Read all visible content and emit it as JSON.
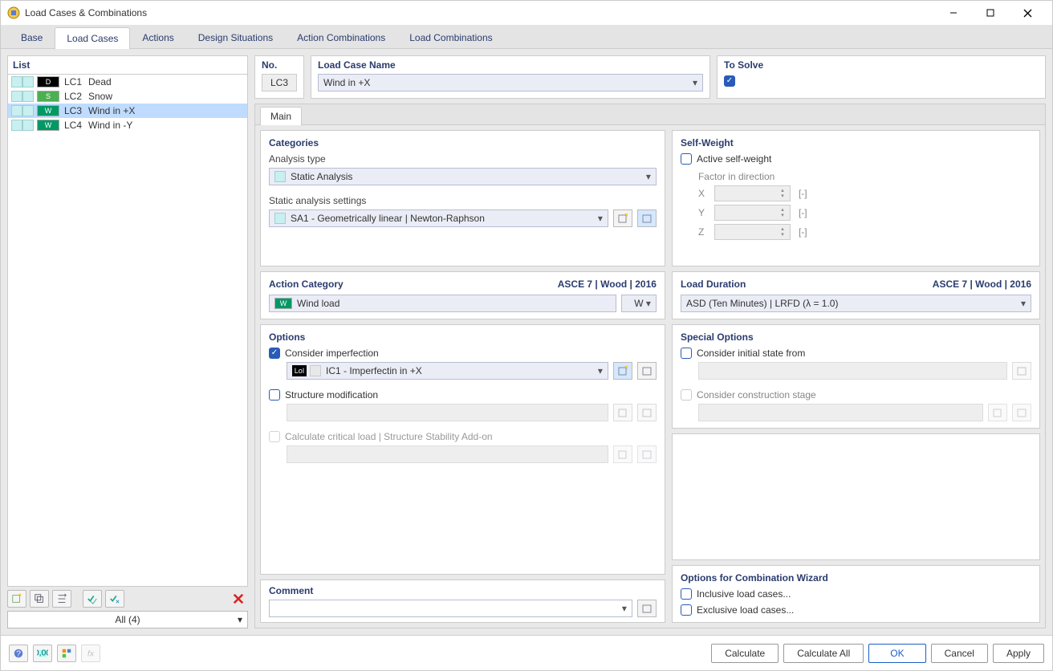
{
  "window": {
    "title": "Load Cases & Combinations"
  },
  "tabs": {
    "items": [
      "Base",
      "Load Cases",
      "Actions",
      "Design Situations",
      "Action Combinations",
      "Load Combinations"
    ],
    "active": 1
  },
  "list": {
    "header": "List",
    "rows": [
      {
        "badge": "D",
        "badge_cls": "black",
        "lc": "LC1",
        "name": "Dead"
      },
      {
        "badge": "S",
        "badge_cls": "green",
        "lc": "LC2",
        "name": "Snow"
      },
      {
        "badge": "W",
        "badge_cls": "darkgreen",
        "lc": "LC3",
        "name": "Wind in +X"
      },
      {
        "badge": "W",
        "badge_cls": "darkgreen",
        "lc": "LC4",
        "name": "Wind in -Y"
      }
    ],
    "selected": 2,
    "filter": "All (4)"
  },
  "header_form": {
    "no_label": "No.",
    "no_value": "LC3",
    "name_label": "Load Case Name",
    "name_value": "Wind in +X",
    "tosolve_label": "To Solve"
  },
  "inner_tabs": {
    "items": [
      "Main"
    ]
  },
  "categories": {
    "title": "Categories",
    "analysis_type_label": "Analysis type",
    "analysis_type_value": "Static Analysis",
    "static_settings_label": "Static analysis settings",
    "static_settings_value": "SA1 - Geometrically linear | Newton-Raphson"
  },
  "self_weight": {
    "title": "Self-Weight",
    "active_label": "Active self-weight",
    "factor_label": "Factor in direction",
    "axes": [
      "X",
      "Y",
      "Z"
    ],
    "bracket": "[-]"
  },
  "action_category": {
    "title": "Action Category",
    "sub": "ASCE 7 | Wood | 2016",
    "value": "Wind load",
    "short": "W"
  },
  "load_duration": {
    "title": "Load Duration",
    "sub": "ASCE 7 | Wood | 2016",
    "value": "ASD (Ten Minutes) | LRFD (λ = 1.0)"
  },
  "options": {
    "title": "Options",
    "consider_imperfection": "Consider imperfection",
    "imperfection_badge": "LoI",
    "imperfection_value": "IC1 - Imperfectin in +X",
    "structure_mod": "Structure modification",
    "calc_critical": "Calculate critical load | Structure Stability Add-on"
  },
  "special_options": {
    "title": "Special Options",
    "initial_state": "Consider initial state from",
    "construction_stage": "Consider construction stage"
  },
  "combination_wizard": {
    "title": "Options for Combination Wizard",
    "inclusive": "Inclusive load cases...",
    "exclusive": "Exclusive load cases..."
  },
  "comment": {
    "title": "Comment"
  },
  "footer": {
    "calculate": "Calculate",
    "calculate_all": "Calculate All",
    "ok": "OK",
    "cancel": "Cancel",
    "apply": "Apply"
  }
}
